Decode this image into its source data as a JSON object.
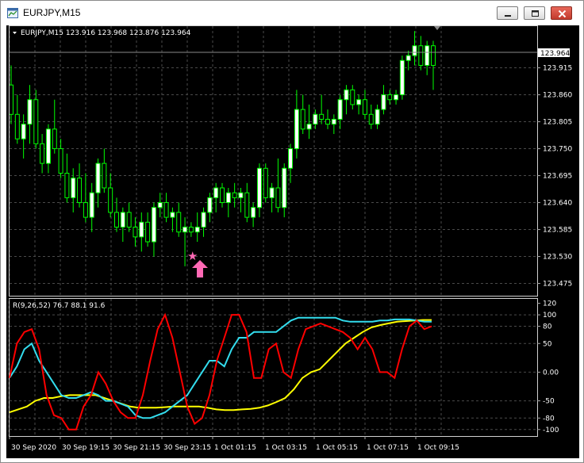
{
  "window": {
    "title": "EURJPY,M15",
    "icon": "chart-window-icon",
    "buttons": [
      "minimize-icon",
      "maximize-icon",
      "close-icon"
    ]
  },
  "main_chart": {
    "header": "EURJPY,M15  123.916 123.968 123.876 123.964",
    "current_price": "123.964",
    "price_axis": [
      "123.915",
      "123.860",
      "123.805",
      "123.750",
      "123.695",
      "123.640",
      "123.585",
      "123.530",
      "123.475"
    ],
    "colors": {
      "bull": "#ffffff",
      "bear": "#000000",
      "wick": "#00ff00",
      "grid": "#4a4a4a",
      "axis_text": "#ffffff"
    },
    "arrow_marker": {
      "icon": "buy-arrow-icon",
      "color": "#ff69b4"
    },
    "star_marker": {
      "icon": "star-icon",
      "color": "#ff69b4"
    }
  },
  "indicator": {
    "label": "R(9,26,52) 76.7 88.1 91.6",
    "scale": [
      "120",
      "100",
      "80",
      "50",
      "0.00",
      "-50",
      "-80",
      "-100"
    ],
    "colors": {
      "fast": "#ff0000",
      "mid": "#33ddee",
      "slow": "#ffff00"
    }
  },
  "time_axis": [
    "30 Sep 2020",
    "30 Sep 19:15",
    "30 Sep 21:15",
    "30 Sep 23:15",
    "1 Oct 01:15",
    "1 Oct 03:15",
    "1 Oct 05:15",
    "1 Oct 07:15",
    "1 Oct 09:15"
  ],
  "chart_data": {
    "type": "candlestick",
    "symbol": "EURJPY",
    "timeframe": "M15",
    "ylim": [
      123.45,
      124.0
    ],
    "candles": [
      {
        "o": 123.88,
        "h": 123.92,
        "l": 123.8,
        "c": 123.82
      },
      {
        "o": 123.82,
        "h": 123.86,
        "l": 123.76,
        "c": 123.77
      },
      {
        "o": 123.77,
        "h": 123.82,
        "l": 123.73,
        "c": 123.8
      },
      {
        "o": 123.8,
        "h": 123.88,
        "l": 123.76,
        "c": 123.85
      },
      {
        "o": 123.85,
        "h": 123.87,
        "l": 123.75,
        "c": 123.76
      },
      {
        "o": 123.76,
        "h": 123.78,
        "l": 123.7,
        "c": 123.72
      },
      {
        "o": 123.72,
        "h": 123.8,
        "l": 123.7,
        "c": 123.79
      },
      {
        "o": 123.79,
        "h": 123.85,
        "l": 123.74,
        "c": 123.75
      },
      {
        "o": 123.75,
        "h": 123.77,
        "l": 123.69,
        "c": 123.7
      },
      {
        "o": 123.7,
        "h": 123.74,
        "l": 123.64,
        "c": 123.65
      },
      {
        "o": 123.65,
        "h": 123.71,
        "l": 123.62,
        "c": 123.69
      },
      {
        "o": 123.69,
        "h": 123.72,
        "l": 123.63,
        "c": 123.64
      },
      {
        "o": 123.64,
        "h": 123.7,
        "l": 123.6,
        "c": 123.61
      },
      {
        "o": 123.61,
        "h": 123.68,
        "l": 123.58,
        "c": 123.66
      },
      {
        "o": 123.66,
        "h": 123.73,
        "l": 123.63,
        "c": 123.72
      },
      {
        "o": 123.72,
        "h": 123.75,
        "l": 123.66,
        "c": 123.67
      },
      {
        "o": 123.67,
        "h": 123.7,
        "l": 123.61,
        "c": 123.62
      },
      {
        "o": 123.62,
        "h": 123.65,
        "l": 123.58,
        "c": 123.59
      },
      {
        "o": 123.59,
        "h": 123.63,
        "l": 123.56,
        "c": 123.62
      },
      {
        "o": 123.62,
        "h": 123.64,
        "l": 123.58,
        "c": 123.59
      },
      {
        "o": 123.59,
        "h": 123.61,
        "l": 123.55,
        "c": 123.57
      },
      {
        "o": 123.57,
        "h": 123.62,
        "l": 123.54,
        "c": 123.6
      },
      {
        "o": 123.6,
        "h": 123.62,
        "l": 123.55,
        "c": 123.56
      },
      {
        "o": 123.56,
        "h": 123.64,
        "l": 123.53,
        "c": 123.63
      },
      {
        "o": 123.63,
        "h": 123.66,
        "l": 123.61,
        "c": 123.64
      },
      {
        "o": 123.64,
        "h": 123.66,
        "l": 123.6,
        "c": 123.61
      },
      {
        "o": 123.61,
        "h": 123.63,
        "l": 123.58,
        "c": 123.62
      },
      {
        "o": 123.62,
        "h": 123.64,
        "l": 123.57,
        "c": 123.58
      },
      {
        "o": 123.58,
        "h": 123.61,
        "l": 123.51,
        "c": 123.59
      },
      {
        "o": 123.59,
        "h": 123.6,
        "l": 123.57,
        "c": 123.58
      },
      {
        "o": 123.58,
        "h": 123.62,
        "l": 123.56,
        "c": 123.59
      },
      {
        "o": 123.59,
        "h": 123.63,
        "l": 123.57,
        "c": 123.62
      },
      {
        "o": 123.62,
        "h": 123.66,
        "l": 123.6,
        "c": 123.65
      },
      {
        "o": 123.65,
        "h": 123.68,
        "l": 123.62,
        "c": 123.67
      },
      {
        "o": 123.67,
        "h": 123.68,
        "l": 123.63,
        "c": 123.64
      },
      {
        "o": 123.64,
        "h": 123.67,
        "l": 123.61,
        "c": 123.66
      },
      {
        "o": 123.66,
        "h": 123.68,
        "l": 123.63,
        "c": 123.65
      },
      {
        "o": 123.65,
        "h": 123.67,
        "l": 123.62,
        "c": 123.66
      },
      {
        "o": 123.66,
        "h": 123.68,
        "l": 123.6,
        "c": 123.61
      },
      {
        "o": 123.61,
        "h": 123.64,
        "l": 123.59,
        "c": 123.63
      },
      {
        "o": 123.63,
        "h": 123.72,
        "l": 123.61,
        "c": 123.71
      },
      {
        "o": 123.71,
        "h": 123.72,
        "l": 123.64,
        "c": 123.65
      },
      {
        "o": 123.65,
        "h": 123.68,
        "l": 123.62,
        "c": 123.67
      },
      {
        "o": 123.67,
        "h": 123.73,
        "l": 123.62,
        "c": 123.63
      },
      {
        "o": 123.63,
        "h": 123.72,
        "l": 123.61,
        "c": 123.71
      },
      {
        "o": 123.71,
        "h": 123.76,
        "l": 123.68,
        "c": 123.75
      },
      {
        "o": 123.75,
        "h": 123.87,
        "l": 123.73,
        "c": 123.83
      },
      {
        "o": 123.83,
        "h": 123.86,
        "l": 123.78,
        "c": 123.79
      },
      {
        "o": 123.79,
        "h": 123.84,
        "l": 123.77,
        "c": 123.8
      },
      {
        "o": 123.8,
        "h": 123.83,
        "l": 123.79,
        "c": 123.82
      },
      {
        "o": 123.82,
        "h": 123.86,
        "l": 123.8,
        "c": 123.81
      },
      {
        "o": 123.81,
        "h": 123.83,
        "l": 123.79,
        "c": 123.8
      },
      {
        "o": 123.8,
        "h": 123.82,
        "l": 123.78,
        "c": 123.81
      },
      {
        "o": 123.81,
        "h": 123.86,
        "l": 123.79,
        "c": 123.85
      },
      {
        "o": 123.85,
        "h": 123.88,
        "l": 123.82,
        "c": 123.87
      },
      {
        "o": 123.87,
        "h": 123.88,
        "l": 123.83,
        "c": 123.84
      },
      {
        "o": 123.84,
        "h": 123.86,
        "l": 123.82,
        "c": 123.85
      },
      {
        "o": 123.85,
        "h": 123.87,
        "l": 123.81,
        "c": 123.82
      },
      {
        "o": 123.82,
        "h": 123.84,
        "l": 123.79,
        "c": 123.8
      },
      {
        "o": 123.8,
        "h": 123.84,
        "l": 123.79,
        "c": 123.83
      },
      {
        "o": 123.83,
        "h": 123.88,
        "l": 123.82,
        "c": 123.86
      },
      {
        "o": 123.86,
        "h": 123.87,
        "l": 123.84,
        "c": 123.85
      },
      {
        "o": 123.85,
        "h": 123.87,
        "l": 123.84,
        "c": 123.86
      },
      {
        "o": 123.86,
        "h": 123.94,
        "l": 123.85,
        "c": 123.93
      },
      {
        "o": 123.93,
        "h": 123.95,
        "l": 123.91,
        "c": 123.94
      },
      {
        "o": 123.94,
        "h": 123.99,
        "l": 123.92,
        "c": 123.96
      },
      {
        "o": 123.96,
        "h": 123.98,
        "l": 123.91,
        "c": 123.92
      },
      {
        "o": 123.92,
        "h": 123.97,
        "l": 123.9,
        "c": 123.96
      },
      {
        "o": 123.96,
        "h": 123.97,
        "l": 123.87,
        "c": 123.92
      }
    ],
    "indicator": {
      "name": "R(9,26,52)",
      "ylim": [
        -110,
        125
      ],
      "series": [
        {
          "name": "fast",
          "values": [
            -10,
            50,
            70,
            75,
            40,
            -40,
            -75,
            -80,
            -100,
            -100,
            -60,
            -40,
            0,
            -20,
            -50,
            -70,
            -80,
            -80,
            -40,
            20,
            75,
            100,
            60,
            0,
            -60,
            -90,
            -80,
            -40,
            20,
            60,
            100,
            100,
            70,
            -10,
            -10,
            40,
            50,
            0,
            -10,
            40,
            75,
            80,
            85,
            80,
            75,
            70,
            60,
            40,
            60,
            40,
            0,
            0,
            -10,
            40,
            80,
            90,
            75,
            80
          ]
        },
        {
          "name": "mid",
          "values": [
            -10,
            10,
            40,
            50,
            20,
            0,
            -20,
            -40,
            -45,
            -45,
            -40,
            -35,
            -40,
            -50,
            -50,
            -55,
            -60,
            -75,
            -80,
            -80,
            -75,
            -70,
            -60,
            -50,
            -40,
            -20,
            0,
            20,
            20,
            10,
            40,
            60,
            60,
            70,
            70,
            70,
            70,
            80,
            90,
            95,
            95,
            95,
            95,
            95,
            95,
            90,
            88,
            88,
            88,
            88,
            90,
            90,
            92,
            92,
            92,
            90,
            88,
            88
          ]
        },
        {
          "name": "slow",
          "values": [
            -70,
            -65,
            -60,
            -50,
            -45,
            -45,
            -42,
            -40,
            -40,
            -40,
            -40,
            -45,
            -50,
            -55,
            -60,
            -62,
            -62,
            -62,
            -61,
            -60,
            -60,
            -60,
            -60,
            -62,
            -65,
            -66,
            -66,
            -65,
            -64,
            -62,
            -58,
            -52,
            -45,
            -30,
            -10,
            0,
            5,
            20,
            35,
            50,
            60,
            70,
            78,
            82,
            85,
            88,
            89,
            90,
            91,
            91
          ]
        }
      ]
    }
  }
}
